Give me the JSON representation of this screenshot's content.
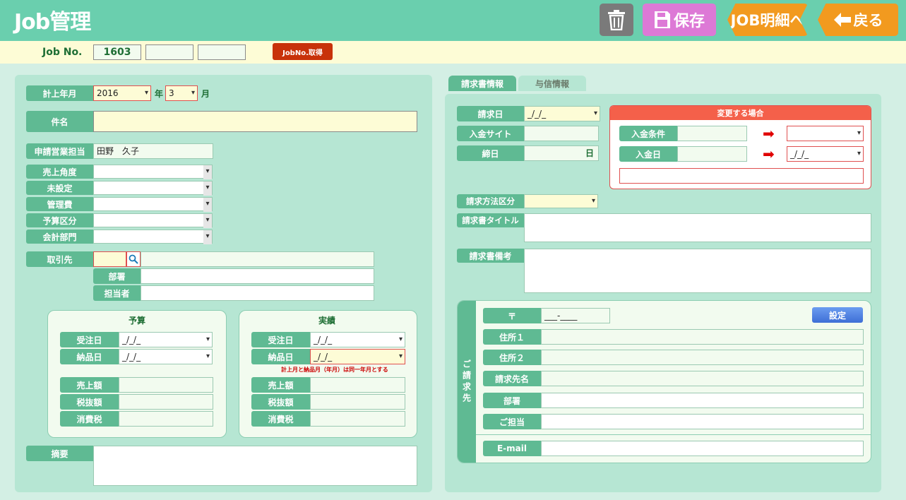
{
  "header": {
    "title": "Job管理",
    "save_label": "保存",
    "job_detail_label": "JOB明細へ",
    "back_label": "戻る"
  },
  "jobbar": {
    "label": "Job No.",
    "job_no": "1603",
    "get_no_label": "JobNo.取得"
  },
  "left": {
    "month_label": "計上年月",
    "year_value": "2016",
    "year_unit": "年",
    "month_value": "3",
    "month_unit": "月",
    "subject_label": "件名",
    "sales_rep_label": "申請営業担当",
    "sales_rep_value": "田野　久子",
    "sales_angle_label": "売上角度",
    "unset_label": "未設定",
    "admin_fee_label": "管理費",
    "budget_cat_label": "予算区分",
    "accounting_dept_label": "会計部門",
    "client_label": "取引先",
    "dept_label": "部署",
    "person_label": "担当者",
    "budget": {
      "title": "予算",
      "order_date_label": "受注日",
      "order_date_value": "_/_/_",
      "delivery_date_label": "納品日",
      "delivery_date_value": "_/_/_",
      "sales_label": "売上額",
      "taxex_label": "税抜額",
      "tax_label": "消費税"
    },
    "actual": {
      "title": "実績",
      "order_date_label": "受注日",
      "order_date_value": "_/_/_",
      "delivery_date_label": "納品日",
      "delivery_date_value": "_/_/_",
      "note": "計上月と納品月（年月）は同一年月とする",
      "sales_label": "売上額",
      "taxex_label": "税抜額",
      "tax_label": "消費税"
    },
    "summary_label": "摘要"
  },
  "right": {
    "tab_invoice": "請求書情報",
    "tab_credit": "与信情報",
    "invoice_date_label": "請求日",
    "invoice_date_value": "_/_/_",
    "payment_site_label": "入金サイト",
    "closing_label": "締日",
    "closing_unit": "日",
    "change_header": "変更する場合",
    "payment_terms_label": "入金条件",
    "payment_date_label": "入金日",
    "payment_date_value": "_/_/_",
    "billing_method_label": "請求方法区分",
    "invoice_title_label": "請求書タイトル",
    "invoice_note_label": "請求書備考",
    "billing_side": "ご請求先",
    "postal_label": "〒",
    "postal_value": "___-____",
    "set_label": "設定",
    "address1_label": "住所１",
    "address2_label": "住所２",
    "billing_name_label": "請求先名",
    "billing_dept_label": "部署",
    "billing_person_label": "ご担当",
    "email_label": "E-mail"
  }
}
